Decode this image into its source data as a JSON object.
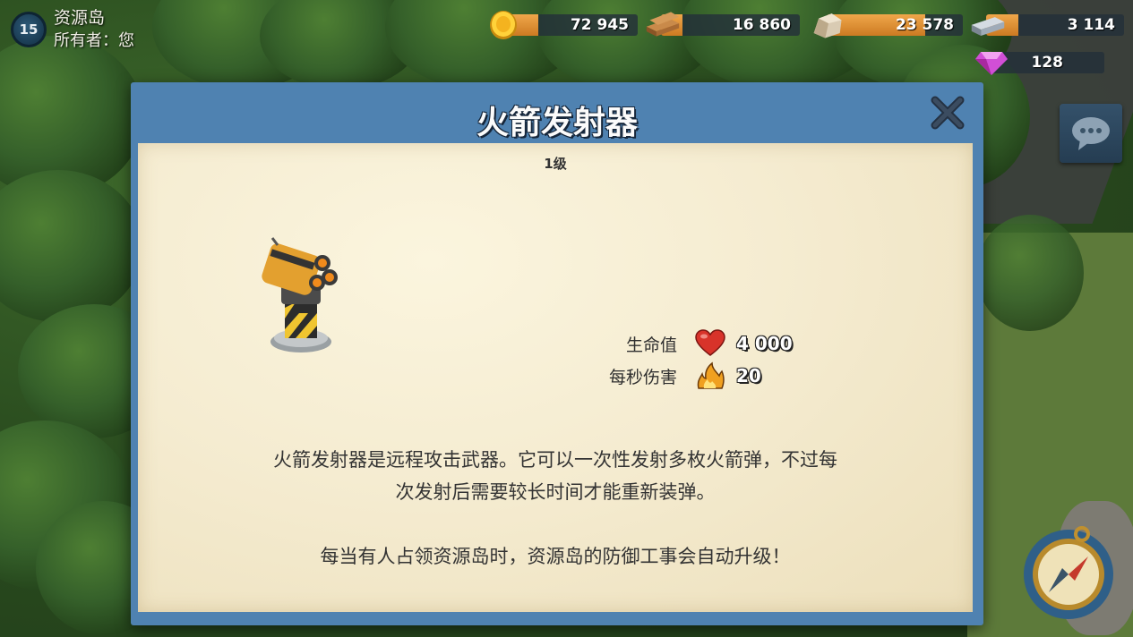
{
  "player": {
    "level": "15",
    "island_name": "资源岛",
    "owner": "所有者：您"
  },
  "resources": {
    "gold": "72 945",
    "wood": "16 860",
    "stone": "23 578",
    "iron": "3 114",
    "diamonds": "128"
  },
  "dialog": {
    "title": "火箭发射器",
    "level": "1级",
    "stats": [
      {
        "label": "生命值",
        "icon": "heart-icon",
        "value": "4 000"
      },
      {
        "label": "每秒伤害",
        "icon": "fire-icon",
        "value": "20"
      }
    ],
    "description_line1": "火箭发射器是远程攻击武器。它可以一次性发射多枚火箭弹，不过每",
    "description_line2": "次发射后需要较长时间才能重新装弹。",
    "note": "每当有人占领资源岛时，资源岛的防御工事会自动升级！"
  },
  "colors": {
    "dialog_border": "#4f82b1",
    "paper": "#f5ecd1",
    "resource_fill": "#e39438"
  }
}
